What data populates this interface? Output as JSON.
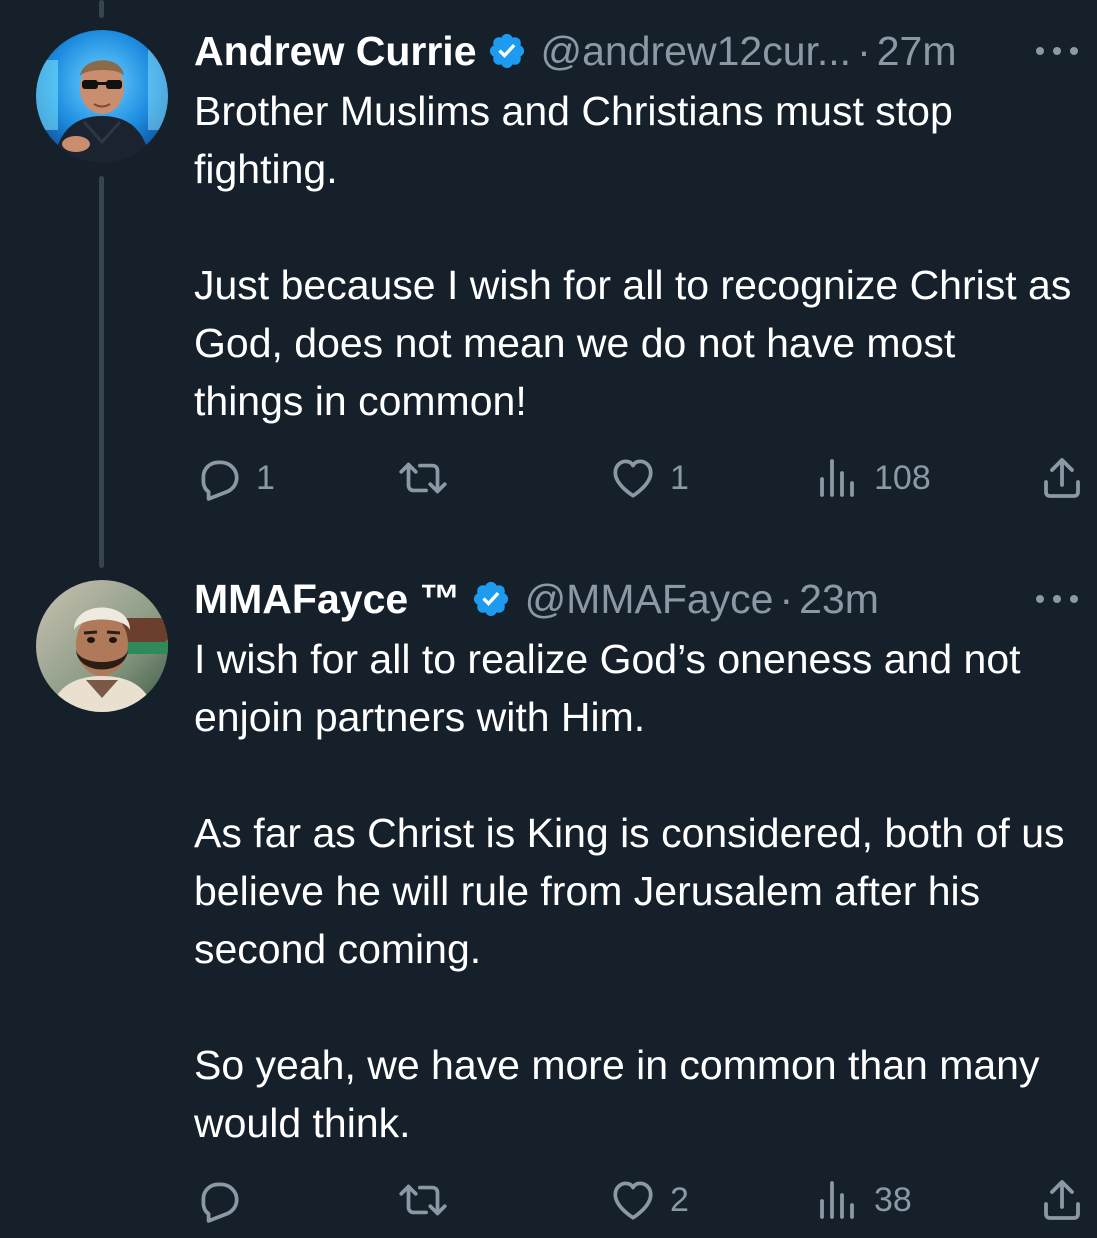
{
  "colors": {
    "background": "#15202b",
    "text_primary": "#ffffff",
    "text_secondary": "#8b98a5",
    "verified_badge": "#1d9bf0",
    "thread_line": "#38444d"
  },
  "tweets": [
    {
      "name": "Andrew Currie",
      "handle": "@andrew12cur...",
      "separator": "·",
      "time": "27m",
      "verified_icon": "verified-badge-icon",
      "more_icon": "more-dots-icon",
      "avatar_icon": "avatar",
      "paragraphs": [
        "Brother Muslims and Christians must stop fighting.",
        "Just because I wish for all to recognize Christ as God, does not mean we do not have most things in common!"
      ],
      "actions": {
        "reply": {
          "icon": "reply-icon",
          "count": "1"
        },
        "retweet": {
          "icon": "retweet-icon",
          "count": ""
        },
        "like": {
          "icon": "heart-icon",
          "count": "1"
        },
        "views": {
          "icon": "views-icon",
          "count": "108"
        },
        "share": {
          "icon": "share-icon"
        }
      }
    },
    {
      "name": "MMAFayce ™",
      "handle": "@MMAFayce",
      "separator": "·",
      "time": "23m",
      "verified_icon": "verified-badge-icon",
      "more_icon": "more-dots-icon",
      "avatar_icon": "avatar",
      "paragraphs": [
        "I wish for all to realize God’s oneness and not enjoin partners with Him.",
        "As far as Christ is King is considered, both of us believe he will rule from Jerusalem after his second coming.",
        "So yeah, we have more in common than many would think."
      ],
      "actions": {
        "reply": {
          "icon": "reply-icon",
          "count": ""
        },
        "retweet": {
          "icon": "retweet-icon",
          "count": ""
        },
        "like": {
          "icon": "heart-icon",
          "count": "2"
        },
        "views": {
          "icon": "views-icon",
          "count": "38"
        },
        "share": {
          "icon": "share-icon"
        }
      }
    }
  ]
}
